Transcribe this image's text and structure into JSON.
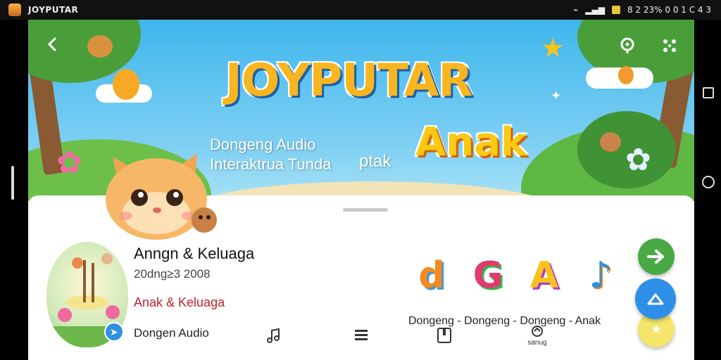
{
  "status_bar": {
    "app_name": "JOYPUTAR",
    "indicators": "8 2 23% 0 0 1 C 4 3"
  },
  "banner": {
    "title": "JOYPUTAR",
    "subtitle_line1": "Dongeng Audio",
    "subtitle_line2": "Interaktrua Tunda",
    "subtitle_line3": "ptak",
    "highlight": "Anak",
    "back_icon": "chevron-left-icon",
    "share_icon": "location-share-icon",
    "more_icon": "dots-grid-icon"
  },
  "story": {
    "title": "Anngn & Keluaga",
    "date": "20dng≥3 2008",
    "category": "Anak & Keluaga",
    "type": "Dongen Audio"
  },
  "toolbar": {
    "items": [
      {
        "icon": "music-note-icon"
      },
      {
        "icon": "list-icon"
      },
      {
        "icon": "book-icon"
      },
      {
        "icon": "share-icon",
        "label": "sanug"
      }
    ]
  },
  "categories": {
    "labels": "Dongeng - Dongeng - Dongeng -  Anak",
    "tiles": [
      "d",
      "G",
      "A",
      "♪"
    ]
  },
  "fabs": {
    "next_icon": "arrow-right-icon",
    "up_icon": "triangle-up-icon",
    "yellow_icon": "star-icon"
  },
  "colors": {
    "banner_sky": "#3fb6ec",
    "title_yellow": "#f7b51f",
    "category_red": "#c0242b",
    "fab_green": "#49a944",
    "fab_blue": "#2f8fe8",
    "fab_yellow": "#f4e66a"
  }
}
